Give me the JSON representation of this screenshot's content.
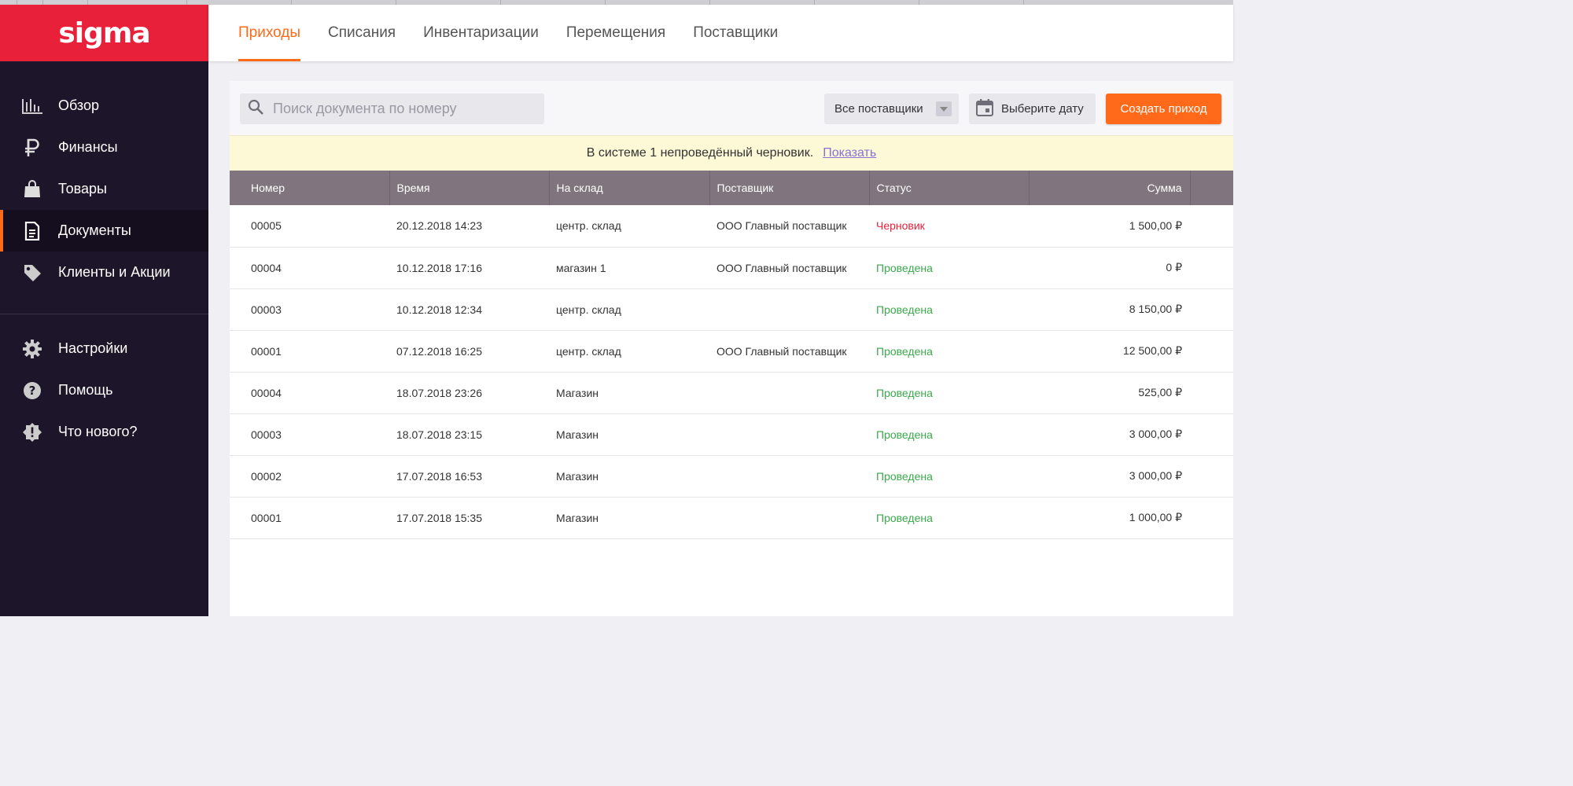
{
  "app": {
    "logo": "sigma"
  },
  "sidebar": {
    "items": [
      {
        "label": "Обзор",
        "icon": "chart-bars-icon"
      },
      {
        "label": "Финансы",
        "icon": "ruble-icon"
      },
      {
        "label": "Товары",
        "icon": "shopping-bag-icon"
      },
      {
        "label": "Документы",
        "icon": "document-icon",
        "active": true
      },
      {
        "label": "Клиенты и Акции",
        "icon": "tag-icon"
      }
    ],
    "secondary": [
      {
        "label": "Настройки",
        "icon": "gear-icon"
      },
      {
        "label": "Помощь",
        "icon": "help-icon"
      },
      {
        "label": "Что нового?",
        "icon": "badge-alert-icon"
      }
    ]
  },
  "tabs": [
    {
      "label": "Приходы",
      "active": true
    },
    {
      "label": "Списания"
    },
    {
      "label": "Инвентаризации"
    },
    {
      "label": "Перемещения"
    },
    {
      "label": "Поставщики"
    }
  ],
  "toolbar": {
    "search_placeholder": "Поиск документа по номеру",
    "supplier_filter": "Все поставщики",
    "date_label": "Выберите дату",
    "create_label": "Создать приход"
  },
  "notice": {
    "text": "В системе 1 непроведённый черновик.",
    "link": "Показать"
  },
  "table": {
    "headers": [
      "Номер",
      "Время",
      "На склад",
      "Поставщик",
      "Статус",
      "Сумма"
    ],
    "rows": [
      {
        "number": "00005",
        "time": "20.12.2018 14:23",
        "warehouse": "центр. склад",
        "supplier": "ООО Главный поставщик",
        "status": "Черновик",
        "status_type": "draft",
        "sum": "1 500,00 ₽"
      },
      {
        "number": "00004",
        "time": "10.12.2018 17:16",
        "warehouse": "магазин 1",
        "supplier": "ООО Главный поставщик",
        "status": "Проведена",
        "status_type": "done",
        "sum": "0 ₽"
      },
      {
        "number": "00003",
        "time": "10.12.2018 12:34",
        "warehouse": "центр. склад",
        "supplier": "",
        "status": "Проведена",
        "status_type": "done",
        "sum": "8 150,00 ₽"
      },
      {
        "number": "00001",
        "time": "07.12.2018 16:25",
        "warehouse": "центр. склад",
        "supplier": "ООО Главный поставщик",
        "status": "Проведена",
        "status_type": "done",
        "sum": "12 500,00 ₽"
      },
      {
        "number": "00004",
        "time": "18.07.2018 23:26",
        "warehouse": "Магазин",
        "supplier": "",
        "status": "Проведена",
        "status_type": "done",
        "sum": "525,00 ₽"
      },
      {
        "number": "00003",
        "time": "18.07.2018 23:15",
        "warehouse": "Магазин",
        "supplier": "",
        "status": "Проведена",
        "status_type": "done",
        "sum": "3 000,00 ₽"
      },
      {
        "number": "00002",
        "time": "17.07.2018 16:53",
        "warehouse": "Магазин",
        "supplier": "",
        "status": "Проведена",
        "status_type": "done",
        "sum": "3 000,00 ₽"
      },
      {
        "number": "00001",
        "time": "17.07.2018 15:35",
        "warehouse": "Магазин",
        "supplier": "",
        "status": "Проведена",
        "status_type": "done",
        "sum": "1 000,00 ₽"
      }
    ]
  },
  "colors": {
    "brand": "#e8203a",
    "accent": "#ff6a1a",
    "sidebar": "#1d1529",
    "draft": "#e8203a",
    "done": "#3aa94c"
  }
}
